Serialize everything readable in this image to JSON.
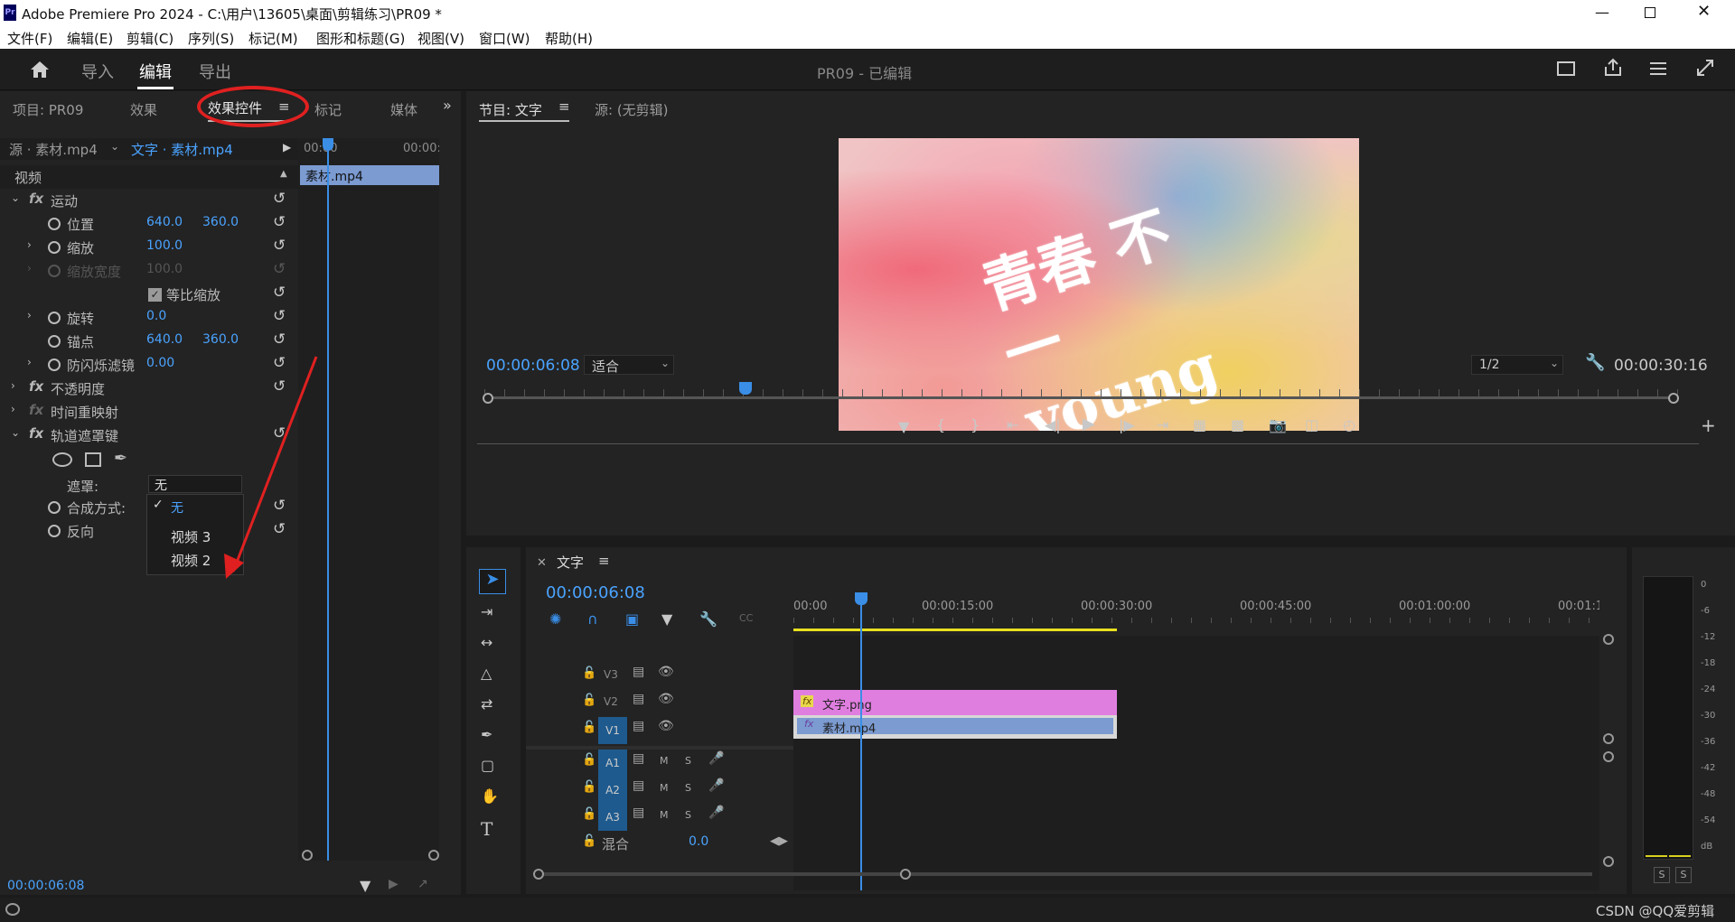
{
  "window": {
    "title": "Adobe Premiere Pro 2024 - C:\\用户\\13605\\桌面\\剪辑练习\\PR09 *",
    "app_badge": "Pr"
  },
  "menu": [
    "文件(F)",
    "编辑(E)",
    "剪辑(C)",
    "序列(S)",
    "标记(M)",
    "图形和标题(G)",
    "视图(V)",
    "窗口(W)",
    "帮助(H)"
  ],
  "topbar": {
    "tabs": [
      "导入",
      "编辑",
      "导出"
    ],
    "active": "编辑",
    "project_title": "PR09 - 已编辑"
  },
  "left_panel": {
    "tabs": [
      "项目: PR09",
      "效果",
      "效果控件",
      "标记",
      "媒体"
    ],
    "active_tab": "效果控件",
    "source": "源 · 素材.mp4",
    "target": "文字 · 素材.mp4",
    "mini_timeline": {
      "start": "00:00",
      "end": "00:00:",
      "clip": "素材.mp4"
    },
    "section": "视频",
    "props": [
      {
        "label": "运动",
        "fx": true
      },
      {
        "label": "位置",
        "v1": "640.0",
        "v2": "360.0"
      },
      {
        "label": "缩放",
        "v1": "100.0"
      },
      {
        "label": "缩放宽度",
        "v1": "100.0",
        "disabled": true
      },
      {
        "label": "等比缩放",
        "checkbox": true
      },
      {
        "label": "旋转",
        "v1": "0.0"
      },
      {
        "label": "锚点",
        "v1": "640.0",
        "v2": "360.0"
      },
      {
        "label": "防闪烁滤镜",
        "v1": "0.00"
      },
      {
        "label": "不透明度",
        "fx": true
      },
      {
        "label": "时间重映射",
        "fx": true
      },
      {
        "label": "轨道遮罩键",
        "fx": true
      },
      {
        "label": "遮罩:",
        "select": "无"
      },
      {
        "label": "合成方式:"
      },
      {
        "label": "反向"
      }
    ],
    "dropdown": {
      "items": [
        "无",
        "视频 3",
        "视频 2"
      ],
      "selected": "无"
    },
    "timecode": "00:00:06:08"
  },
  "program": {
    "tabs": [
      "节目: 文字",
      "源: (无剪辑)"
    ],
    "timecode": "00:00:06:08",
    "fit": "适合",
    "resolution": "1/2",
    "duration": "00:00:30:16",
    "artwork": "青春 不一young"
  },
  "timeline": {
    "sequence": "文字",
    "timecode": "00:00:06:08",
    "ruler": [
      "00:00",
      "00:00:15:00",
      "00:00:30:00",
      "00:00:45:00",
      "00:01:00:00",
      "00:01:1"
    ],
    "video_tracks": [
      "V3",
      "V2",
      "V1"
    ],
    "audio_tracks": [
      "A1",
      "A2",
      "A3"
    ],
    "mix_label": "混合",
    "mix_value": "0.0",
    "clips": [
      {
        "name": "文字.png",
        "track": "V2",
        "color": "#e07ee0"
      },
      {
        "name": "素材.mp4",
        "track": "V1",
        "color": "#7b9bd1"
      }
    ],
    "audio_letters": [
      "M",
      "S"
    ]
  },
  "meter": {
    "scale": [
      "0",
      "-6",
      "-12",
      "-18",
      "-24",
      "-30",
      "-36",
      "-42",
      "-48",
      "-54",
      "dB"
    ],
    "solo": [
      "S",
      "S"
    ]
  },
  "watermark": "CSDN @QQ爱剪辑"
}
